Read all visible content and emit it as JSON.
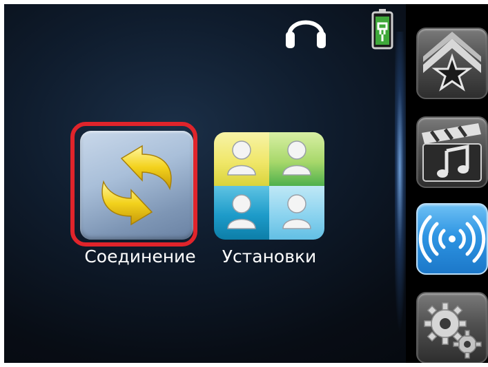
{
  "status_bar": {
    "headphones_icon": "headphones-icon",
    "battery_icon": "battery-charging-icon"
  },
  "main_menu": {
    "items": [
      {
        "label": "Соединение",
        "icon": "sync-arrows-icon",
        "selected": true
      },
      {
        "label": "Установки",
        "icon": "users-grid-icon",
        "selected": false
      }
    ]
  },
  "sidebar": {
    "buttons": [
      {
        "icon": "favorites-star-icon",
        "active": false
      },
      {
        "icon": "media-music-icon",
        "active": false
      },
      {
        "icon": "wireless-signal-icon",
        "active": true
      },
      {
        "icon": "gears-icon",
        "active": false
      }
    ]
  },
  "colors": {
    "highlight": "#e0242b",
    "active_sidebar": "#2e95e3",
    "background": "#0f1c2d"
  }
}
